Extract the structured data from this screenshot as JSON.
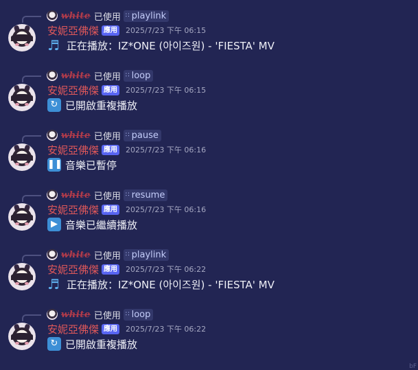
{
  "messages": [
    {
      "reply_user": "white",
      "used_text": "已使用",
      "command": "playlink",
      "author": "安妮亞佛傑",
      "bot_tag": "應用",
      "timestamp": "2025/7/23 下午 06:15",
      "emoji_icon": "musical-notes-icon",
      "content": "正在播放：IZ*ONE (아이즈원) - 'FIESTA' MV"
    },
    {
      "reply_user": "white",
      "used_text": "已使用",
      "command": "loop",
      "author": "安妮亞佛傑",
      "bot_tag": "應用",
      "timestamp": "2025/7/23 下午 06:15",
      "emoji_icon": "repeat-icon",
      "content": "已開啟重複播放"
    },
    {
      "reply_user": "white",
      "used_text": "已使用",
      "command": "pause",
      "author": "安妮亞佛傑",
      "bot_tag": "應用",
      "timestamp": "2025/7/23 下午 06:16",
      "emoji_icon": "pause-icon",
      "content": "音樂已暫停"
    },
    {
      "reply_user": "white",
      "used_text": "已使用",
      "command": "resume",
      "author": "安妮亞佛傑",
      "bot_tag": "應用",
      "timestamp": "2025/7/23 下午 06:16",
      "emoji_icon": "play-icon",
      "content": "音樂已繼續播放"
    },
    {
      "reply_user": "white",
      "used_text": "已使用",
      "command": "playlink",
      "author": "安妮亞佛傑",
      "bot_tag": "應用",
      "timestamp": "2025/7/23 下午 06:22",
      "emoji_icon": "musical-notes-icon",
      "content": "正在播放：IZ*ONE (아이즈원) - 'FIESTA' MV"
    },
    {
      "reply_user": "white",
      "used_text": "已使用",
      "command": "loop",
      "author": "安妮亞佛傑",
      "bot_tag": "應用",
      "timestamp": "2025/7/23 下午 06:22",
      "emoji_icon": "repeat-icon",
      "content": "已開啟重複播放"
    }
  ],
  "corner_text": "bF",
  "colors": {
    "background": "#222553",
    "author": "#e0585a",
    "reply_user": "#b23b4a",
    "bot_tag_bg": "#5865f2",
    "command_bg": "#33386b",
    "emoji_box": "#3d8fd6",
    "notes": "#5fb2f1"
  }
}
